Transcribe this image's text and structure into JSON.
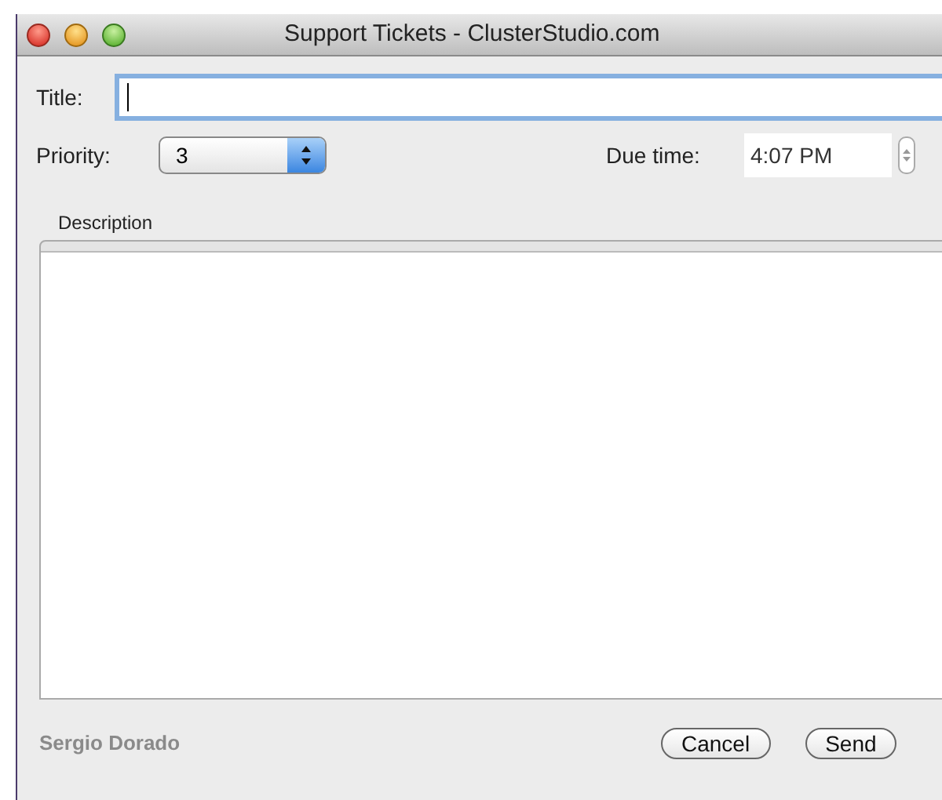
{
  "window": {
    "title": "Support Tickets - ClusterStudio.com"
  },
  "title_field": {
    "label": "Title:",
    "focused": true
  },
  "priority": {
    "label": "Priority:",
    "value": "3"
  },
  "due_time": {
    "label": "Due time:",
    "value": "4:07 PM"
  },
  "description": {
    "label": "Description"
  },
  "user_name": "Sergio Dorado",
  "buttons": [
    {
      "label": "Cancel"
    },
    {
      "label": "Send"
    }
  ]
}
